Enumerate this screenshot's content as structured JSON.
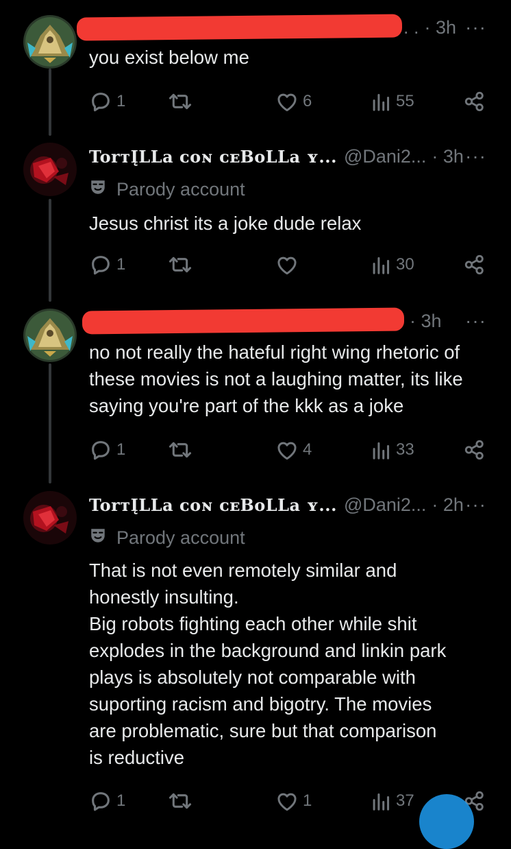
{
  "tweets": [
    {
      "display_name": "",
      "handle": "",
      "time": "· 3h",
      "more": "···",
      "parody_label": "",
      "text": "you exist below me",
      "replies": "1",
      "retweets": "",
      "likes": "6",
      "views": "55"
    },
    {
      "display_name": "TorᴛĮLLa ᴄoɴ ᴄᴇBoLLa ʏ...",
      "handle": "@Dani2...",
      "time": "· 3h",
      "more": "···",
      "parody_label": "Parody account",
      "text": "Jesus christ its a joke dude relax",
      "replies": "1",
      "retweets": "",
      "likes": "",
      "views": "30"
    },
    {
      "display_name": "",
      "handle": "",
      "time": "· 3h",
      "more": "···",
      "parody_label": "",
      "text": "no not really the hateful right wing rhetoric of these movies is not a laughing matter, its like saying you're part of the kkk as a joke",
      "replies": "1",
      "retweets": "",
      "likes": "4",
      "views": "33"
    },
    {
      "display_name": "TorᴛĮLLa ᴄoɴ ᴄᴇBoLLa ʏ...",
      "handle": "@Dani2...",
      "time": "· 2h",
      "more": "···",
      "parody_label": "Parody account",
      "text_lines": [
        "That is not even remotely similar and",
        "honestly insulting.",
        "Big robots fighting each other while shit",
        "explodes in the background and linkin park",
        "plays is absolutely not comparable with",
        "suporting racism and bigotry. The movies",
        "are problematic, sure but that comparison",
        "is reductive"
      ],
      "replies": "1",
      "retweets": "",
      "likes": "1",
      "views": "37"
    }
  ],
  "icons": {
    "reply": "reply-icon",
    "retweet": "retweet-icon",
    "like": "heart-icon",
    "views": "views-icon",
    "share": "share-icon",
    "parody": "parody-mask-icon"
  },
  "colors": {
    "background": "#000000",
    "text": "#e7e9ea",
    "muted": "#71767b",
    "redaction": "#f23a33",
    "accent": "#1d9bf0"
  }
}
